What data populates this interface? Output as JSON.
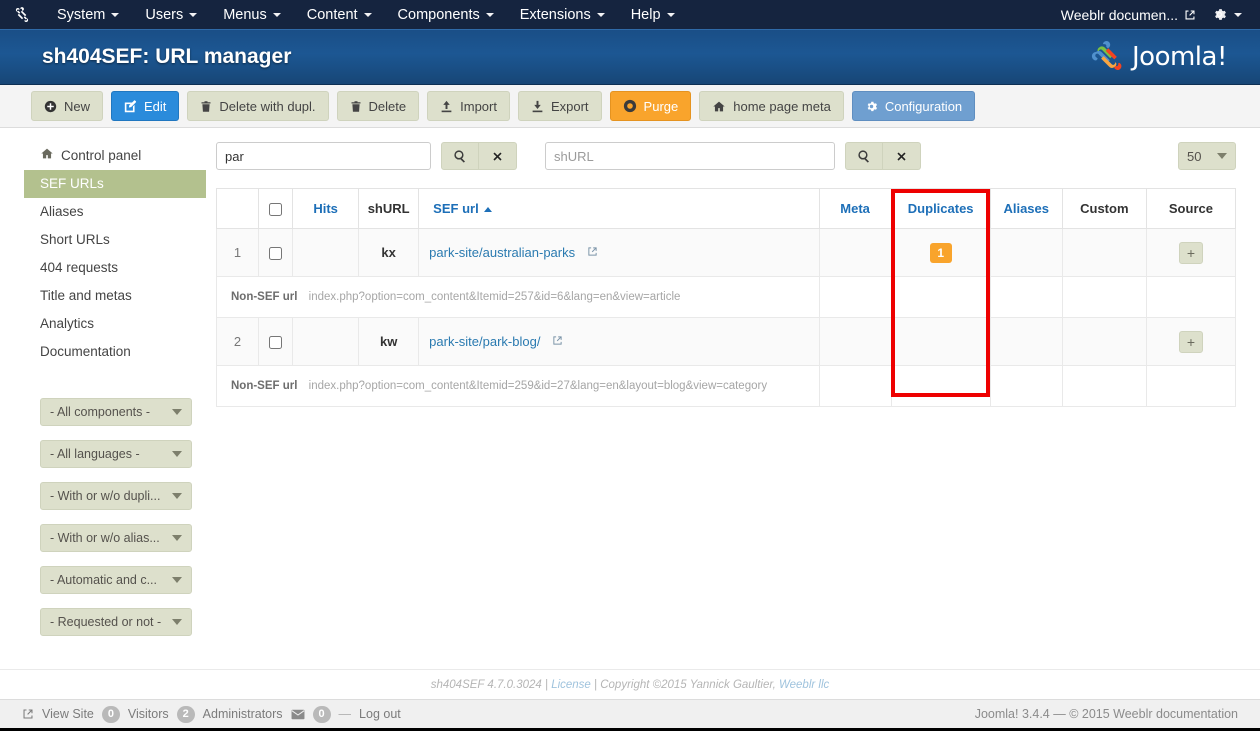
{
  "topbar": {
    "logo_icon": "joomla-brand-icon",
    "menu": [
      {
        "label": "System",
        "caret": true
      },
      {
        "label": "Users",
        "caret": true
      },
      {
        "label": "Menus",
        "caret": true
      },
      {
        "label": "Content",
        "caret": true
      },
      {
        "label": "Components",
        "caret": true
      },
      {
        "label": "Extensions",
        "caret": true
      },
      {
        "label": "Help",
        "caret": true
      }
    ],
    "user_label": "Weeblr documen...",
    "user_icon": "external-link-icon",
    "gear_icon": "gear-icon"
  },
  "header": {
    "title": "sh404SEF: URL manager",
    "brand": "Joomla!"
  },
  "toolbar": {
    "buttons": [
      {
        "label": "New",
        "icon": "plus-circle-icon",
        "style": "default"
      },
      {
        "label": "Edit",
        "icon": "pencil-square-icon",
        "style": "primary"
      },
      {
        "label": "Delete with dupl.",
        "icon": "trash-icon",
        "style": "default"
      },
      {
        "label": "Delete",
        "icon": "trash-icon",
        "style": "default"
      },
      {
        "label": "Import",
        "icon": "upload-icon",
        "style": "default"
      },
      {
        "label": "Export",
        "icon": "download-icon",
        "style": "default"
      },
      {
        "label": "Purge",
        "icon": "purge-circle-icon",
        "style": "warn"
      },
      {
        "label": "home page meta",
        "icon": "home-icon",
        "style": "default"
      },
      {
        "label": "Configuration",
        "icon": "gear-icon",
        "style": "info"
      }
    ]
  },
  "sidebar": {
    "items": [
      {
        "label": "Control panel",
        "icon": "home-icon",
        "active": false
      },
      {
        "label": "SEF URLs",
        "icon": "",
        "active": true
      },
      {
        "label": "Aliases",
        "icon": "",
        "active": false
      },
      {
        "label": "Short URLs",
        "icon": "",
        "active": false
      },
      {
        "label": "404 requests",
        "icon": "",
        "active": false
      },
      {
        "label": "Title and metas",
        "icon": "",
        "active": false
      },
      {
        "label": "Analytics",
        "icon": "",
        "active": false
      },
      {
        "label": "Documentation",
        "icon": "",
        "active": false
      }
    ],
    "filters": [
      {
        "label": "- All components -"
      },
      {
        "label": "- All languages -"
      },
      {
        "label": "- With or w/o dupli..."
      },
      {
        "label": "- With or w/o alias..."
      },
      {
        "label": "- Automatic and c..."
      },
      {
        "label": "- Requested or not -"
      }
    ]
  },
  "filters": {
    "search_value": "par",
    "search_placeholder": "",
    "shurl_value": "",
    "shurl_placeholder": "shURL",
    "search_icon": "magnifier-icon",
    "clear_icon": "x-icon",
    "limit_value": "50"
  },
  "table": {
    "columns": [
      {
        "key": "num",
        "label": ""
      },
      {
        "key": "chk",
        "label": ""
      },
      {
        "key": "hits",
        "label": "Hits"
      },
      {
        "key": "shurl",
        "label": "shURL"
      },
      {
        "key": "sefurl",
        "label": "SEF url",
        "sorted": "asc"
      },
      {
        "key": "meta",
        "label": "Meta"
      },
      {
        "key": "duplicates",
        "label": "Duplicates",
        "highlighted": true
      },
      {
        "key": "aliases",
        "label": "Aliases"
      },
      {
        "key": "custom",
        "label": "Custom"
      },
      {
        "key": "source",
        "label": "Source"
      }
    ],
    "nonsef_label": "Non-SEF url",
    "rows": [
      {
        "num": "1",
        "hits": "",
        "shurl": "kx",
        "sefurl": "park-site/australian-parks",
        "meta": "",
        "duplicates": "1",
        "aliases": "",
        "custom": "",
        "source": "+",
        "nonsef": "index.php?option=com_content&Itemid=257&id=6&lang=en&view=article"
      },
      {
        "num": "2",
        "hits": "",
        "shurl": "kw",
        "sefurl": "park-site/park-blog/",
        "meta": "",
        "duplicates": "",
        "aliases": "",
        "custom": "",
        "source": "+",
        "nonsef": "index.php?option=com_content&Itemid=259&id=27&lang=en&layout=blog&view=category"
      }
    ]
  },
  "subfooter": {
    "version": "sh404SEF 4.7.0.3024",
    "sep1": "|",
    "license": "License",
    "sep2": "|",
    "copyright": "Copyright ©2015 Yannick Gaultier,",
    "company": "Weeblr llc"
  },
  "statusbar": {
    "view_site": "View Site",
    "view_site_icon": "external-link-icon",
    "visitors_count": "0",
    "visitors_label": "Visitors",
    "admins_count": "2",
    "admins_label": "Administrators",
    "mail_icon": "envelope-icon",
    "messages_count": "0",
    "logout": "Log out",
    "right_text": "Joomla! 3.4.4  —  © 2015 Weeblr documentation"
  },
  "annotation": {
    "highlight_column": "Duplicates",
    "color": "#ee0000"
  }
}
